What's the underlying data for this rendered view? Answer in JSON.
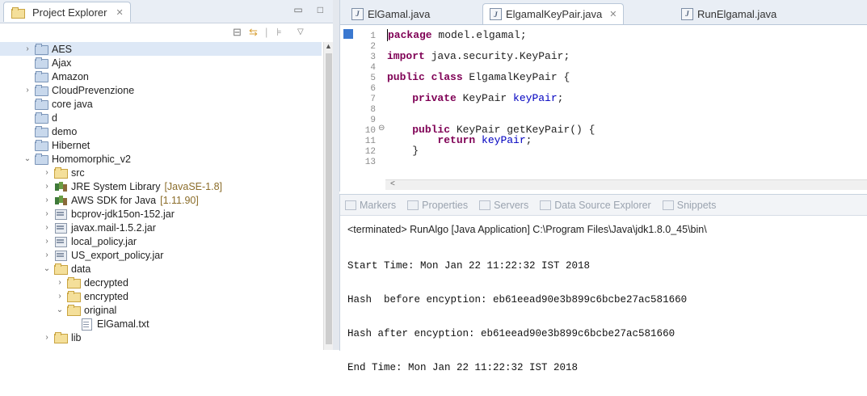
{
  "explorer": {
    "tab_title": "Project Explorer",
    "tab_close": "✕",
    "minimize": "▭",
    "maximize": "□",
    "tree": [
      {
        "label": "AES",
        "expanded": false,
        "icon": "project-folder-icon"
      },
      {
        "label": "Ajax",
        "icon": "folder-icon"
      },
      {
        "label": "Amazon",
        "icon": "folder-icon"
      },
      {
        "label": "CloudPrevenzione",
        "expanded": false,
        "icon": "project-folder-icon"
      },
      {
        "label": "core java",
        "icon": "folder-icon"
      },
      {
        "label": "d",
        "icon": "folder-icon"
      },
      {
        "label": "demo",
        "icon": "folder-icon"
      },
      {
        "label": "Hibernet",
        "icon": "folder-icon"
      },
      {
        "label": "Homomorphic_v2",
        "expanded": true,
        "icon": "project-folder-icon"
      },
      {
        "label": "src",
        "icon": "source-folder-icon"
      },
      {
        "label": "JRE System Library",
        "decoration": "[JavaSE-1.8]",
        "icon": "library-icon"
      },
      {
        "label": "AWS SDK for Java",
        "decoration": "[1.11.90]",
        "icon": "library-icon"
      },
      {
        "label": "bcprov-jdk15on-152.jar",
        "icon": "jar-icon"
      },
      {
        "label": "javax.mail-1.5.2.jar",
        "icon": "jar-icon"
      },
      {
        "label": "local_policy.jar",
        "icon": "jar-icon"
      },
      {
        "label": "US_export_policy.jar",
        "icon": "jar-icon"
      },
      {
        "label": "data",
        "expanded": true,
        "icon": "folder-icon"
      },
      {
        "label": "decrypted",
        "icon": "folder-icon"
      },
      {
        "label": "encrypted",
        "icon": "folder-icon"
      },
      {
        "label": "original",
        "expanded": true,
        "icon": "folder-icon"
      },
      {
        "label": "ElGamal.txt",
        "icon": "text-file-icon"
      },
      {
        "label": "lib",
        "icon": "folder-icon"
      }
    ]
  },
  "editor": {
    "tabs": [
      {
        "label": "ElGamal.java",
        "active": false
      },
      {
        "label": "ElgamalKeyPair.java",
        "active": true
      },
      {
        "label": "RunElgamal.java",
        "active": false
      }
    ],
    "line_numbers": [
      "1",
      "2",
      "3",
      "4",
      "5",
      "6",
      "7",
      "8",
      "9",
      "10",
      "11",
      "12",
      "13"
    ],
    "code": {
      "l1_kw": "package",
      "l1_rest": " model.elgamal;",
      "l3_kw": "import",
      "l3_rest": " java.security.KeyPair;",
      "l5_kw": "public class",
      "l5_rest": " ElgamalKeyPair {",
      "l7_kw": "private",
      "l7_type": " KeyPair ",
      "l7_field": "keyPair",
      "l7_end": ";",
      "l10_kw": "public",
      "l10_rest": " KeyPair getKeyPair() {",
      "l11_kw": "return",
      "l11_field": "keyPair",
      "l11_end": ";",
      "l12": "}",
      "l10_fold": "⊖"
    },
    "scroll_arrow": "<"
  },
  "console": {
    "tabs": [
      "Markers",
      "Properties",
      "Servers",
      "Data Source Explorer",
      "Snippets"
    ],
    "status": "<terminated> RunAlgo [Java Application] C:\\Program Files\\Java\\jdk1.8.0_45\\bin\\",
    "lines": [
      "Start Time: Mon Jan 22 11:22:32 IST 2018",
      "Hash  before encyption: eb61eead90e3b899c6bcbe27ac581660",
      "Hash after encyption: eb61eead90e3b899c6bcbe27ac581660",
      "End Time: Mon Jan 22 11:22:32 IST 2018"
    ]
  }
}
